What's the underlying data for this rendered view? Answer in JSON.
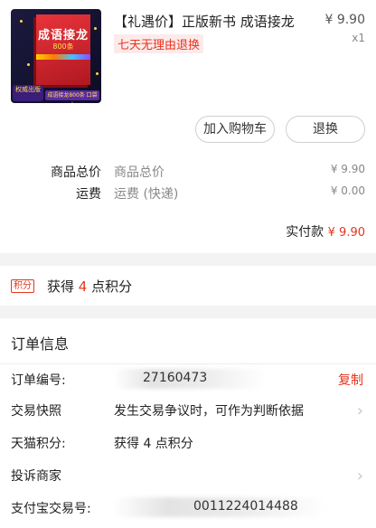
{
  "product": {
    "title": "【礼遇价】正版新书 成语接龙",
    "price": "¥ 9.90",
    "quantity": "x1",
    "promo": "七天无理由退换",
    "image": {
      "book_title": "成语接龙",
      "book_subtitle": "800条",
      "badge": "权威出版",
      "tagline": "成语接龙800条 口袋本"
    }
  },
  "actions": {
    "add_to_cart": "加入购物车",
    "refund": "退换"
  },
  "summary": {
    "goods_total_label": "商品总价",
    "goods_total_value": "商品总价",
    "goods_total_amount": "¥ 9.90",
    "shipping_label": "运费",
    "shipping_value": "运费 (快递)",
    "shipping_amount": "¥ 0.00",
    "paid_label": "实付款",
    "paid_amount": "¥ 9.90"
  },
  "points": {
    "tag": "积分",
    "prefix": "获得",
    "count": "4",
    "suffix": "点积分"
  },
  "order_info": {
    "title": "订单信息",
    "order_no_label": "订单编号:",
    "order_no_value": "27160473",
    "copy": "复制",
    "snapshot_label": "交易快照",
    "snapshot_value": "发生交易争议时，可作为判断依据",
    "tmall_points_label": "天猫积分:",
    "tmall_points_value": "获得 4 点积分",
    "complain_label": "投诉商家",
    "alipay_label": "支付宝交易号:",
    "alipay_value": "0011224014488"
  },
  "colors": {
    "accent": "#e8341c",
    "promo_bg": "#fdeaea",
    "muted": "#888888"
  }
}
